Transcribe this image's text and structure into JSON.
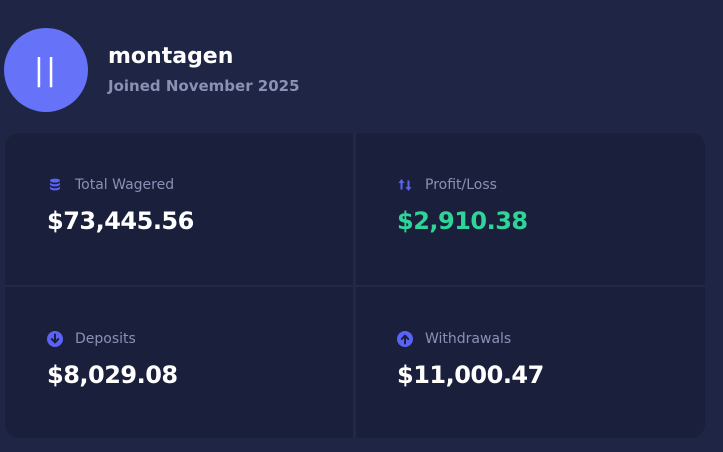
{
  "profile": {
    "avatar_text": "||",
    "username": "montagen",
    "joined": "Joined November 2025"
  },
  "stats": {
    "total_wagered": {
      "label": "Total Wagered",
      "value": "$73,445.56",
      "icon": "coins-stack-icon"
    },
    "profit_loss": {
      "label": "Profit/Loss",
      "value": "$2,910.38",
      "icon": "arrows-up-down-icon"
    },
    "deposits": {
      "label": "Deposits",
      "value": "$8,029.08",
      "icon": "arrow-down-circle-icon"
    },
    "withdrawals": {
      "label": "Withdrawals",
      "value": "$11,000.47",
      "icon": "arrow-up-circle-icon"
    }
  },
  "colors": {
    "background": "#1f2544",
    "card": "#1a1f3b",
    "accent": "#6672f8",
    "icon": "#5b63f5",
    "positive": "#2fd498",
    "muted_text": "#8a91b4"
  }
}
